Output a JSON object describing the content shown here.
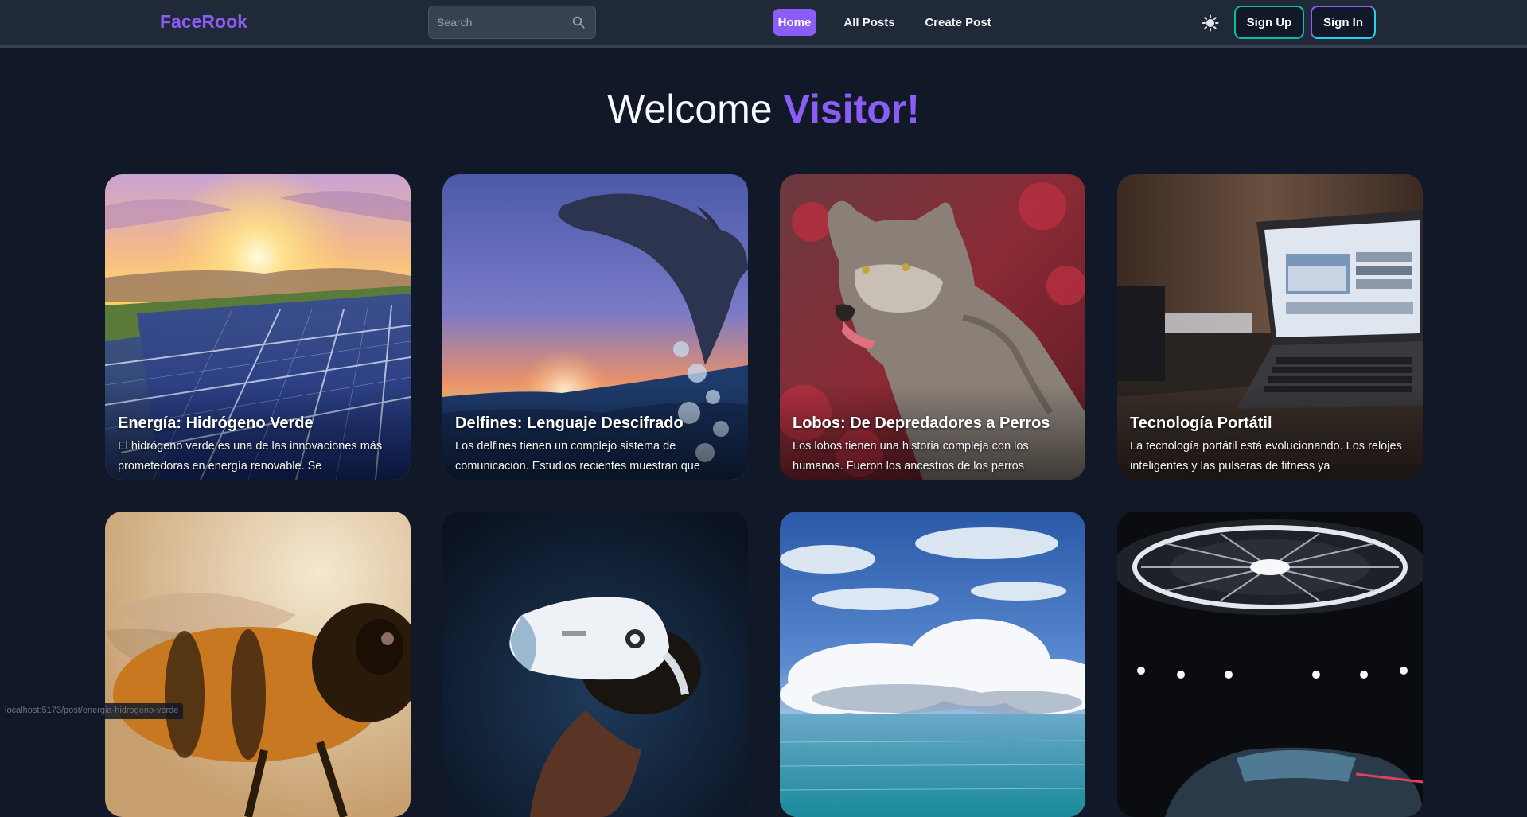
{
  "navbar": {
    "logo": "FaceRook",
    "search_placeholder": "Search",
    "links": {
      "home": "Home",
      "all_posts": "All Posts",
      "create_post": "Create Post"
    },
    "sign_up": "Sign Up",
    "sign_in": "Sign In",
    "theme_icon": "sun-icon"
  },
  "hero": {
    "prefix": "Welcome ",
    "highlight": "Visitor!"
  },
  "posts": [
    {
      "title": "Energía: Hidrógeno Verde",
      "excerpt": "El hidrógeno verde es una de las innovaciones más prometedoras en energía renovable. Se",
      "image": "solar-panels-sunset"
    },
    {
      "title": "Delfines: Lenguaje Descifrado",
      "excerpt": "Los delfines tienen un complejo sistema de comunicación. Estudios recientes muestran que",
      "image": "dolphin-jumping-sunset"
    },
    {
      "title": "Lobos: De Depredadores a Perros",
      "excerpt": "Los lobos tienen una historia compleja con los humanos. Fueron los ancestros de los perros",
      "image": "wolf-red-foliage"
    },
    {
      "title": "Tecnología Portátil",
      "excerpt": "La tecnología portátil está evolucionando. Los relojes inteligentes y las pulseras de fitness ya",
      "image": "laptop-on-desk"
    },
    {
      "title": "",
      "excerpt": "",
      "image": "bee-closeup"
    },
    {
      "title": "",
      "excerpt": "",
      "image": "vr-headset-person"
    },
    {
      "title": "",
      "excerpt": "",
      "image": "clouds-over-sea"
    },
    {
      "title": "",
      "excerpt": "",
      "image": "concept-car-showroom"
    }
  ],
  "status_bar": {
    "url": "localhost:5173/post/energia-hidrogeno-verde"
  },
  "colors": {
    "accent": "#8b5cf6",
    "background": "#111827",
    "navbar": "#1f2937",
    "signup_border": "#14b8a6"
  }
}
